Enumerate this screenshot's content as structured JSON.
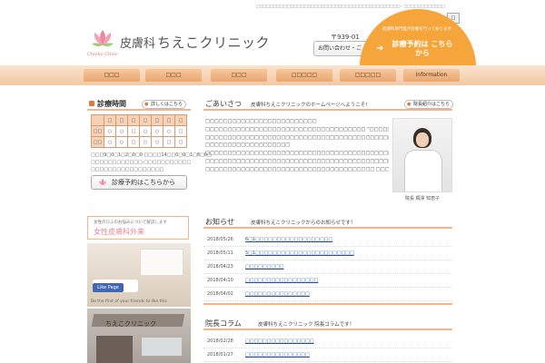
{
  "header": {
    "top_text": "□□□□□□□□□□□□□□□□□□□□□□□□□□□□□□□□□□□□□□□□□□ - □□□□□□□□□□□□",
    "search_button": "□",
    "logo_sub": "Chieko Clinic",
    "logo_title_1": "皮膚科",
    "logo_title_2": "ちえこクリニック",
    "address": "〒939-01",
    "contact_button": "お問い合わせ・ご",
    "badge_small": "皮膚科専門医が診療を行っております",
    "badge_big": "診療予約は こちらから",
    "badge_arrow": "➜"
  },
  "nav": {
    "items": [
      "□□□",
      "□□□",
      "□□□",
      "□□□□□",
      "□□□□□",
      "Information"
    ]
  },
  "sidebar": {
    "hours_title": "診療時間",
    "hours_more": "詳しくはこちら",
    "schedule": {
      "headers": [
        "",
        "□",
        "□",
        "□",
        "□",
        "□",
        "□",
        "□"
      ],
      "rows": [
        {
          "label": "□□",
          "cells": [
            "○",
            "○",
            "□",
            "○",
            "○",
            "○",
            "□"
          ]
        },
        {
          "label": "□□",
          "cells": [
            "○",
            "○",
            "□",
            "○",
            "○",
            "□",
            "□"
          ]
        }
      ]
    },
    "notes": [
      "□□□9□0□1□2□0□0 □□□□14□□0□0□1□8□0□",
      "□□□□□□□□□□□□·□□□□□□□□□□□",
      "□□□□□□□□□□□□□□□□□"
    ],
    "reserve_button": "診療予約はこちらから",
    "banner_small": "女性のひふのお悩みについて解説します",
    "banner_big": "女性皮膚科外来",
    "fb_like": "Like Page",
    "fb_text": "Be the first of your friends to like this",
    "building_sign": "ちえこクリニック"
  },
  "greeting": {
    "title": "ごあいさつ",
    "subtitle": "皮膚科ちえこクリニックのホームページへようこそ!",
    "profile_button": "院長紹介はこちら",
    "paragraphs": [
      "□□□□□□□□□□□□□□□□□□□□□□□□□",
      "□□□□□□□□□□□□□□□□□□□□□□□□□□□□□□□□□□□□ “□□□□□□□□□□□□□□□□□□□□□□□□□”□□□□□□",
      "□□□□□□□□□□□□□□□□□□□□□□□□□□□□□□□□□□□□□□□□□□□□□□□□□□□□□□□□□□□□□□□□□",
      "□□□□□□□□□□□□□□□□□□□",
      "□□□□□□□□□□□□□□□□□□□□□□□□□□□□□□□□□□□□□□□□□□□□□□□□□□□□□□□□□□□□□□□□□",
      "□□□□□□□□□□□□□□□□□□□□□□□□□□□□□□□□□□□□□□□□□□□□□□□□□□□□□□□□□□□□□□□□□",
      "□□□□□□□□□□□□□□□□□□□□□□□□□□□□□□□□□□□□□□ □□□□□□□□□□□□"
    ],
    "doctor_caption": "院長 梶澤 知恵子"
  },
  "news": {
    "title": "お知らせ",
    "subtitle": "皮膚科ちえこクリニックからのお知らせです！",
    "items": [
      {
        "date": "2018/05/26",
        "text": "6□1□□□□□□□□□□□□□□□□□□"
      },
      {
        "date": "2018/05/11",
        "text": "5□1□□□□□□□□□□□□□□□□□□□□□□□"
      },
      {
        "date": "2018/04/23",
        "text": "□□□□□□□□□"
      },
      {
        "date": "2018/04/10",
        "text": "□□□□□□□□□□□□□□□□□"
      },
      {
        "date": "2018/04/02",
        "text": "□□□□□□□□□□□□□□□"
      }
    ]
  },
  "column": {
    "title": "院長コラム",
    "subtitle": "皮膚科ちえこクリニック 院長コラムです！",
    "items": [
      {
        "date": "2018/02/28",
        "text": "□□□□□□□□□□□□□□□□"
      },
      {
        "date": "2018/01/27",
        "text": "□□□□□□□□□□□□□□□"
      }
    ]
  },
  "colors": {
    "accent_orange": "#f6a53a",
    "nav_peach": "#f3c9a4",
    "link_blue": "#2a4f92"
  }
}
